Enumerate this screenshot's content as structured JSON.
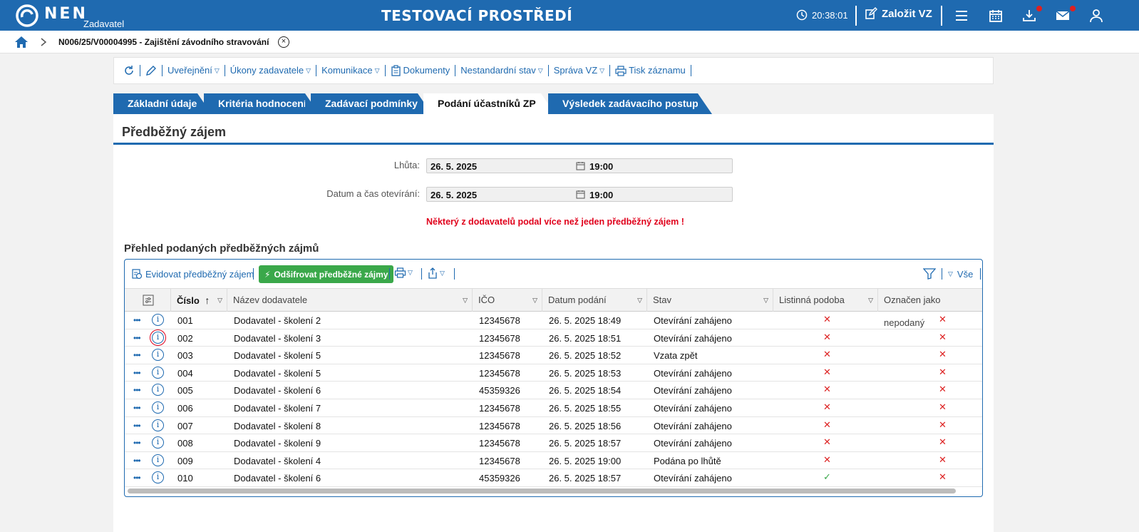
{
  "header": {
    "logo_text": "NEN",
    "logo_sub": "Zadavatel",
    "env_title": "TESTOVACÍ PROSTŘEDÍ",
    "clock": "20:38:01",
    "create_label": "Založit VZ"
  },
  "breadcrumb": {
    "text": "N006/25/V00004995 - Zajištění závodního stravování"
  },
  "toolbar": {
    "items": [
      {
        "label": "Uveřejnění",
        "dropdown": true
      },
      {
        "label": "Úkony zadavatele",
        "dropdown": true
      },
      {
        "label": "Komunikace",
        "dropdown": true
      },
      {
        "label": "Dokumenty",
        "dropdown": false
      },
      {
        "label": "Nestandardní stav",
        "dropdown": true
      },
      {
        "label": "Správa VZ",
        "dropdown": true
      },
      {
        "label": "Tisk záznamu",
        "dropdown": false
      }
    ]
  },
  "tabs": [
    {
      "label": "Základní údaje",
      "active": false
    },
    {
      "label": "Kritéria hodnocení",
      "active": false
    },
    {
      "label": "Zadávací podmínky",
      "active": false
    },
    {
      "label": "Podání účastníků ZP",
      "active": true
    },
    {
      "label": "Výsledek zadávacího postupu",
      "active": false
    }
  ],
  "section": {
    "title": "Předběžný zájem",
    "fields": [
      {
        "label": "Lhůta:",
        "date": "26. 5. 2025",
        "time": "19:00"
      },
      {
        "label": "Datum a čas otevírání:",
        "date": "26. 5. 2025",
        "time": "19:00"
      }
    ],
    "warning": "Některý z dodavatelů podal více než jeden předběžný zájem !"
  },
  "grid": {
    "title": "Přehled podaných předběžných zájmů",
    "register_label": "Evidovat předběžný zájem",
    "decrypt_label": "Odšifrovat předběžné zájmy",
    "filter_all_label": "Vše",
    "columns": [
      "Číslo",
      "Název dodavatele",
      "IČO",
      "Datum podání",
      "Stav",
      "Listinná podoba",
      "Označen jako nepodaný"
    ],
    "rows": [
      {
        "cislo": "001",
        "nazev": "Dodavatel - školení 2",
        "ico": "12345678",
        "datum": "26. 5. 2025 18:49",
        "stav": "Otevírání zahájeno",
        "listinna": false,
        "nepodany": false
      },
      {
        "cislo": "002",
        "nazev": "Dodavatel - školení 3",
        "ico": "12345678",
        "datum": "26. 5. 2025 18:51",
        "stav": "Otevírání zahájeno",
        "listinna": false,
        "nepodany": false
      },
      {
        "cislo": "003",
        "nazev": "Dodavatel - školení 5",
        "ico": "12345678",
        "datum": "26. 5. 2025 18:52",
        "stav": "Vzata zpět",
        "listinna": false,
        "nepodany": false
      },
      {
        "cislo": "004",
        "nazev": "Dodavatel - školení 5",
        "ico": "12345678",
        "datum": "26. 5. 2025 18:53",
        "stav": "Otevírání zahájeno",
        "listinna": false,
        "nepodany": false
      },
      {
        "cislo": "005",
        "nazev": "Dodavatel - školení 6",
        "ico": "45359326",
        "datum": "26. 5. 2025 18:54",
        "stav": "Otevírání zahájeno",
        "listinna": false,
        "nepodany": false
      },
      {
        "cislo": "006",
        "nazev": "Dodavatel - školení 7",
        "ico": "12345678",
        "datum": "26. 5. 2025 18:55",
        "stav": "Otevírání zahájeno",
        "listinna": false,
        "nepodany": false
      },
      {
        "cislo": "007",
        "nazev": "Dodavatel - školení 8",
        "ico": "12345678",
        "datum": "26. 5. 2025 18:56",
        "stav": "Otevírání zahájeno",
        "listinna": false,
        "nepodany": false
      },
      {
        "cislo": "008",
        "nazev": "Dodavatel - školení 9",
        "ico": "12345678",
        "datum": "26. 5. 2025 18:57",
        "stav": "Otevírání zahájeno",
        "listinna": false,
        "nepodany": false
      },
      {
        "cislo": "009",
        "nazev": "Dodavatel - školení 4",
        "ico": "12345678",
        "datum": "26. 5. 2025 19:00",
        "stav": "Podána po lhůtě",
        "listinna": false,
        "nepodany": false
      },
      {
        "cislo": "010",
        "nazev": "Dodavatel - školení 6",
        "ico": "45359326",
        "datum": "26. 5. 2025 18:57",
        "stav": "Otevírání zahájeno",
        "listinna": true,
        "nepodany": false
      }
    ]
  },
  "colors": {
    "brand": "#1f6ab0",
    "warning": "#e0001b",
    "success": "#3aa84a",
    "cross": "#dd2222"
  }
}
